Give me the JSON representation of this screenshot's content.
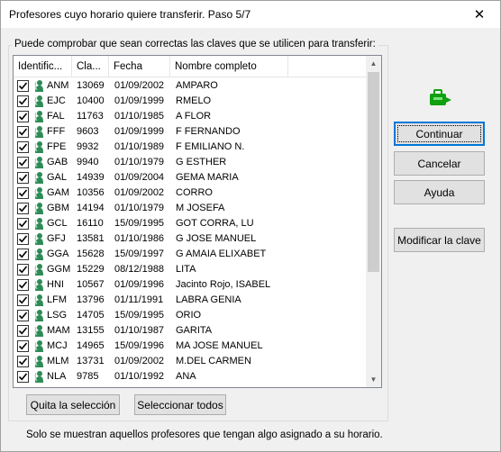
{
  "window": {
    "title": "Profesores cuyo horario quiere transferir. Paso 5/7",
    "close_glyph": "✕"
  },
  "group": {
    "label": "Puede comprobar que sean correctas las claves que se utilicen para transferir:"
  },
  "list": {
    "columns": [
      "Identific...",
      "Cla...",
      "Fecha",
      "Nombre completo"
    ],
    "rows": [
      {
        "id": "ANM",
        "code": "13069",
        "date": "01/09/2002",
        "name": "AMPARO",
        "checked": true
      },
      {
        "id": "EJC",
        "code": "10400",
        "date": "01/09/1999",
        "name": "RMELO",
        "checked": true
      },
      {
        "id": "FAL",
        "code": "11763",
        "date": "01/10/1985",
        "name": "A FLOR",
        "checked": true
      },
      {
        "id": "FFF",
        "code": "9603",
        "date": "01/09/1999",
        "name": "F FERNANDO",
        "checked": true
      },
      {
        "id": "FPE",
        "code": "9932",
        "date": "01/10/1989",
        "name": "F EMILIANO N.",
        "checked": true
      },
      {
        "id": "GAB",
        "code": "9940",
        "date": "01/10/1979",
        "name": "G ESTHER",
        "checked": true
      },
      {
        "id": "GAL",
        "code": "14939",
        "date": "01/09/2004",
        "name": "GEMA MARIA",
        "checked": true
      },
      {
        "id": "GAM",
        "code": "10356",
        "date": "01/09/2002",
        "name": "CORRO",
        "checked": true
      },
      {
        "id": "GBM",
        "code": "14194",
        "date": "01/10/1979",
        "name": "M JOSEFA",
        "checked": true
      },
      {
        "id": "GCL",
        "code": "16110",
        "date": "15/09/1995",
        "name": "GOT CORRA, LU",
        "checked": true
      },
      {
        "id": "GFJ",
        "code": "13581",
        "date": "01/10/1986",
        "name": "G JOSE MANUEL",
        "checked": true
      },
      {
        "id": "GGA",
        "code": "15628",
        "date": "15/09/1997",
        "name": "G AMAIA ELIXABET",
        "checked": true
      },
      {
        "id": "GGM",
        "code": "15229",
        "date": "08/12/1988",
        "name": "LITA",
        "checked": true
      },
      {
        "id": "HNI",
        "code": "10567",
        "date": "01/09/1996",
        "name": "Jacinto Rojo, ISABEL",
        "checked": true
      },
      {
        "id": "LFM",
        "code": "13796",
        "date": "01/11/1991",
        "name": "LABRA GENIA",
        "checked": true
      },
      {
        "id": "LSG",
        "code": "14705",
        "date": "15/09/1995",
        "name": "ORIO",
        "checked": true
      },
      {
        "id": "MAM",
        "code": "13155",
        "date": "01/10/1987",
        "name": "GARITA",
        "checked": true
      },
      {
        "id": "MCJ",
        "code": "14965",
        "date": "15/09/1996",
        "name": "MA JOSE MANUEL",
        "checked": true
      },
      {
        "id": "MLM",
        "code": "13731",
        "date": "01/09/2002",
        "name": "M.DEL CARMEN",
        "checked": true
      },
      {
        "id": "NLA",
        "code": "9785",
        "date": "01/10/1992",
        "name": "ANA",
        "checked": true
      }
    ]
  },
  "buttons": {
    "continuar": "Continuar",
    "cancelar": "Cancelar",
    "ayuda": "Ayuda",
    "modificar": "Modificar la clave",
    "quita": "Quita la selección",
    "seleccionar": "Seleccionar todos"
  },
  "footer": {
    "note": "Solo se muestran aquellos profesores que tengan algo asignado a su horario."
  },
  "icons": {
    "row_icon": "person-icon",
    "app_icon": "transfer-briefcase-icon",
    "accent": "#0078d7",
    "person_green": "#2e8b57",
    "briefcase_green": "#10a010"
  }
}
